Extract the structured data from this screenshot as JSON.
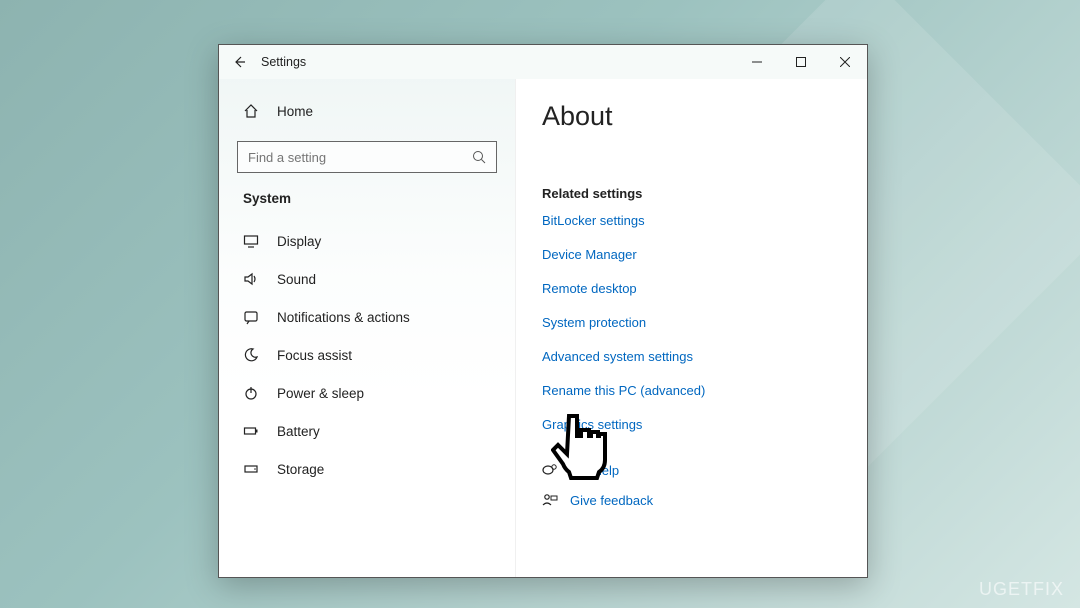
{
  "window": {
    "title": "Settings",
    "controls": {
      "minimize": "—",
      "maximize": "□",
      "close": "✕"
    }
  },
  "sidebar": {
    "home_label": "Home",
    "search_placeholder": "Find a setting",
    "section": "System",
    "items": [
      {
        "icon": "display-icon",
        "label": "Display"
      },
      {
        "icon": "sound-icon",
        "label": "Sound"
      },
      {
        "icon": "notifications-icon",
        "label": "Notifications & actions"
      },
      {
        "icon": "focus-assist-icon",
        "label": "Focus assist"
      },
      {
        "icon": "power-icon",
        "label": "Power & sleep"
      },
      {
        "icon": "battery-icon",
        "label": "Battery"
      },
      {
        "icon": "storage-icon",
        "label": "Storage"
      }
    ]
  },
  "main": {
    "title": "About",
    "related_heading": "Related settings",
    "links": [
      "BitLocker settings",
      "Device Manager",
      "Remote desktop",
      "System protection",
      "Advanced system settings",
      "Rename this PC (advanced)",
      "Graphics settings"
    ],
    "help_label": "Get help",
    "feedback_label": "Give feedback"
  },
  "watermark": "UGETFIX"
}
